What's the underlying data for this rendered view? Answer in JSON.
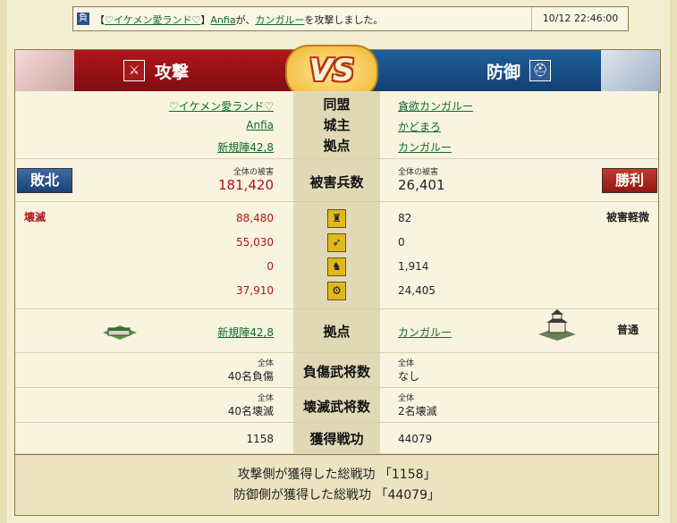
{
  "notice": {
    "badge": "負",
    "prefix": "【",
    "alliance": "♡イケメン愛ランド♡",
    "suffix1": "】",
    "attacker": "Anfia",
    "mid": "が、",
    "target": "カンガルー",
    "tail": "を攻撃しました。",
    "time": "10/12 22:46:00"
  },
  "banner": {
    "attack": "攻撃",
    "vs": "VS",
    "defense": "防御"
  },
  "info": {
    "alliance_label": "同盟",
    "lord_label": "城主",
    "base_label": "拠点",
    "atk_alliance": "♡イケメン愛ランド♡",
    "atk_lord": "Anfia",
    "atk_base": "新規陣42,8",
    "def_alliance": "貪欲カンガルー",
    "def_lord": "かどまろ",
    "def_base": "カンガルー"
  },
  "damage": {
    "label": "被害兵数",
    "atk_total_label": "全体の被害",
    "atk_total": "181,420",
    "atk_result": "敗北",
    "def_total_label": "全体の被害",
    "def_total": "26,401",
    "def_result": "勝利"
  },
  "units": {
    "atk_status": "壊滅",
    "def_status": "被害軽微",
    "rows": [
      {
        "icon": "spear-icon",
        "atk": "88,480",
        "def": "82"
      },
      {
        "icon": "bow-icon",
        "atk": "55,030",
        "def": "0"
      },
      {
        "icon": "horse-icon",
        "atk": "0",
        "def": "1,914"
      },
      {
        "icon": "siege-icon",
        "atk": "37,910",
        "def": "24,405"
      }
    ]
  },
  "base_row": {
    "label": "拠点",
    "atk": "新規陣42,8",
    "def": "カンガルー",
    "def_state": "普通"
  },
  "injured": {
    "label": "負傷武将数",
    "sub": "全体",
    "atk": "40名負傷",
    "def": "なし"
  },
  "destroyed": {
    "label": "壊滅武将数",
    "sub": "全体",
    "atk": "40名壊滅",
    "def": "2名壊滅"
  },
  "merit": {
    "label": "獲得戦功",
    "atk": "1158",
    "def": "44079"
  },
  "footer": {
    "line1": "攻撃側が獲得した総戦功 「1158」",
    "line2": "防御側が獲得した総戦功 「44079」"
  },
  "colors": {
    "attack_red": "#b2151c",
    "defense_blue": "#1f5fa0",
    "link_green": "#0a6b2c"
  }
}
